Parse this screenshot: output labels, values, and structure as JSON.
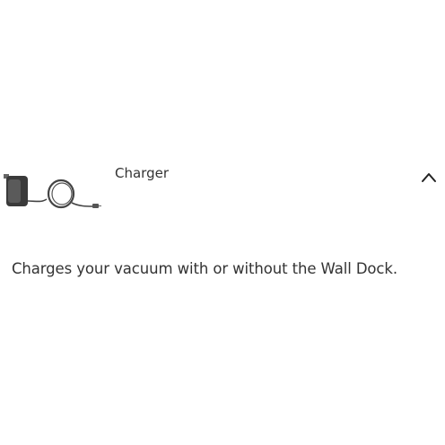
{
  "accordion": {
    "title": "Charger",
    "expanded": true,
    "toggle_icon": "chevron-up-icon",
    "thumbnail_icon": "charger-product-icon",
    "description": "Charges your vacuum with or without the Wall Dock."
  },
  "colors": {
    "text": "#333333",
    "background": "#ffffff",
    "charger_body": "#3a3a3a",
    "cable": "#444444"
  }
}
